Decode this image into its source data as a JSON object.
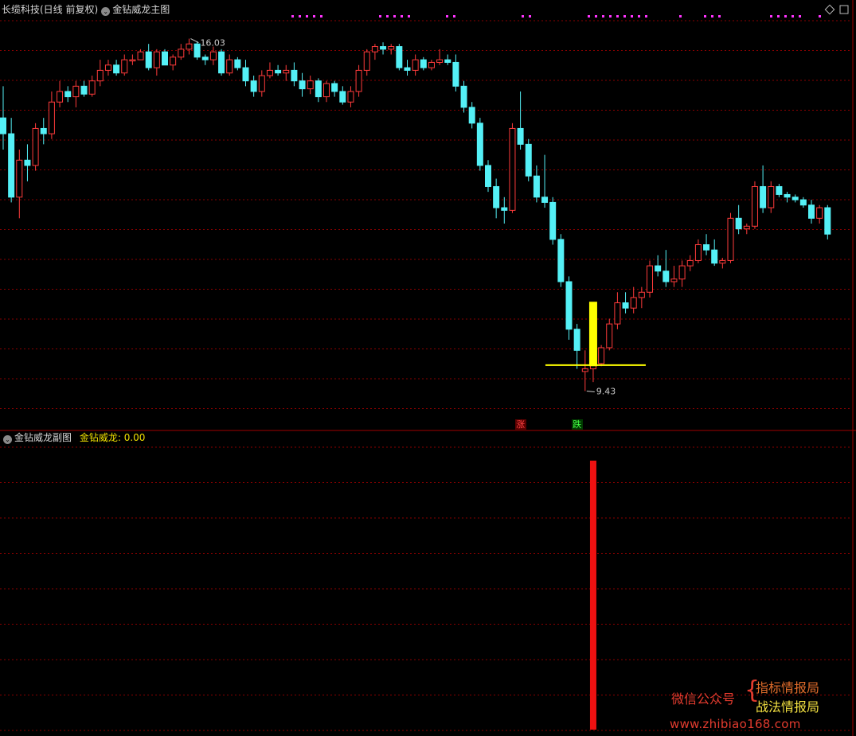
{
  "header": {
    "stock": "长缆科技(日线 前复权)",
    "main_indicator": "金钻威龙主图",
    "sub_indicator": "金钻威龙副图",
    "sub_value_label": "金钻威龙:",
    "sub_value": "0.00"
  },
  "colors": {
    "background": "#000000",
    "up_candle": "#ff3b3b",
    "down_candle": "#54f0f6",
    "grid": "#8a0000",
    "signal_bar": "#ffff00",
    "sub_bar": "#ee1111",
    "magenta_dots": "#ff33ff"
  },
  "chart_data": {
    "type": "candlestick",
    "x_index_note": "",
    "high_marker": "16.03",
    "low_marker": "9.43",
    "tag_up": "涨",
    "tag_down": "跌",
    "candles": [
      [
        14.6,
        15.2,
        14.0,
        14.3
      ],
      [
        14.3,
        14.6,
        13.0,
        13.1
      ],
      [
        13.1,
        14.0,
        12.7,
        13.8
      ],
      [
        13.8,
        14.1,
        13.4,
        13.7
      ],
      [
        13.7,
        14.5,
        13.6,
        14.4
      ],
      [
        14.4,
        14.6,
        14.1,
        14.3
      ],
      [
        14.3,
        15.1,
        14.2,
        14.9
      ],
      [
        14.9,
        15.3,
        14.8,
        15.1
      ],
      [
        15.1,
        15.2,
        14.9,
        15.0
      ],
      [
        15.0,
        15.3,
        14.8,
        15.2
      ],
      [
        15.2,
        15.3,
        15.0,
        15.05
      ],
      [
        15.05,
        15.4,
        15.0,
        15.3
      ],
      [
        15.3,
        15.7,
        15.2,
        15.5
      ],
      [
        15.5,
        15.7,
        15.4,
        15.6
      ],
      [
        15.6,
        15.7,
        15.4,
        15.45
      ],
      [
        15.45,
        15.8,
        15.4,
        15.7
      ],
      [
        15.7,
        15.8,
        15.6,
        15.7
      ],
      [
        15.7,
        15.9,
        15.7,
        15.85
      ],
      [
        15.85,
        16.0,
        15.5,
        15.55
      ],
      [
        15.55,
        15.9,
        15.4,
        15.85
      ],
      [
        15.85,
        15.9,
        15.6,
        15.6
      ],
      [
        15.6,
        15.8,
        15.5,
        15.75
      ],
      [
        15.75,
        16.0,
        15.7,
        15.9
      ],
      [
        15.9,
        16.1,
        15.8,
        16.0
      ],
      [
        16.0,
        16.05,
        15.7,
        15.75
      ],
      [
        15.75,
        15.8,
        15.6,
        15.7
      ],
      [
        15.7,
        15.95,
        15.6,
        15.85
      ],
      [
        15.85,
        15.9,
        15.4,
        15.45
      ],
      [
        15.45,
        15.8,
        15.4,
        15.7
      ],
      [
        15.7,
        15.75,
        15.5,
        15.55
      ],
      [
        15.55,
        15.7,
        15.2,
        15.3
      ],
      [
        15.3,
        15.4,
        15.0,
        15.1
      ],
      [
        15.1,
        15.5,
        15.0,
        15.4
      ],
      [
        15.4,
        15.65,
        15.35,
        15.5
      ],
      [
        15.5,
        15.6,
        15.4,
        15.45
      ],
      [
        15.45,
        15.6,
        15.3,
        15.5
      ],
      [
        15.5,
        15.65,
        15.2,
        15.3
      ],
      [
        15.3,
        15.45,
        15.0,
        15.15
      ],
      [
        15.15,
        15.4,
        15.05,
        15.3
      ],
      [
        15.3,
        15.35,
        14.9,
        15.0
      ],
      [
        15.0,
        15.3,
        14.9,
        15.25
      ],
      [
        15.25,
        15.3,
        15.0,
        15.1
      ],
      [
        15.1,
        15.2,
        14.85,
        14.9
      ],
      [
        14.9,
        15.2,
        14.8,
        15.1
      ],
      [
        15.1,
        15.6,
        15.0,
        15.5
      ],
      [
        15.5,
        15.9,
        15.4,
        15.85
      ],
      [
        15.85,
        16.0,
        15.7,
        15.95
      ],
      [
        15.95,
        16.03,
        15.8,
        15.9
      ],
      [
        15.9,
        16.0,
        15.8,
        15.95
      ],
      [
        15.95,
        16.0,
        15.5,
        15.55
      ],
      [
        15.55,
        15.7,
        15.4,
        15.5
      ],
      [
        15.5,
        15.8,
        15.4,
        15.7
      ],
      [
        15.7,
        15.75,
        15.5,
        15.55
      ],
      [
        15.55,
        15.7,
        15.5,
        15.65
      ],
      [
        15.65,
        15.9,
        15.6,
        15.7
      ],
      [
        15.7,
        15.8,
        15.6,
        15.65
      ],
      [
        15.65,
        15.8,
        15.1,
        15.2
      ],
      [
        15.2,
        15.3,
        14.7,
        14.8
      ],
      [
        14.8,
        14.9,
        14.4,
        14.5
      ],
      [
        14.5,
        14.6,
        13.6,
        13.7
      ],
      [
        13.7,
        13.8,
        13.2,
        13.3
      ],
      [
        13.3,
        13.45,
        12.7,
        12.9
      ],
      [
        12.9,
        13.1,
        12.6,
        12.85
      ],
      [
        12.85,
        14.5,
        12.8,
        14.4
      ],
      [
        14.4,
        15.1,
        14.0,
        14.1
      ],
      [
        14.1,
        14.2,
        13.4,
        13.5
      ],
      [
        13.5,
        13.7,
        13.0,
        13.1
      ],
      [
        13.1,
        13.9,
        12.9,
        13.0
      ],
      [
        13.0,
        13.1,
        12.2,
        12.3
      ],
      [
        12.3,
        12.4,
        11.4,
        11.5
      ],
      [
        11.5,
        11.6,
        10.4,
        10.6
      ],
      [
        10.6,
        10.7,
        9.85,
        10.2
      ],
      [
        9.8,
        10.2,
        9.43,
        9.85
      ],
      [
        9.85,
        10.3,
        9.6,
        9.95
      ],
      [
        9.95,
        10.3,
        9.9,
        10.25
      ],
      [
        10.25,
        10.8,
        10.2,
        10.7
      ],
      [
        10.7,
        11.3,
        10.6,
        11.1
      ],
      [
        11.1,
        11.3,
        10.9,
        11.0
      ],
      [
        11.0,
        11.4,
        10.9,
        11.2
      ],
      [
        11.2,
        11.4,
        11.0,
        11.3
      ],
      [
        11.3,
        11.9,
        11.2,
        11.8
      ],
      [
        11.8,
        12.0,
        11.6,
        11.7
      ],
      [
        11.7,
        12.1,
        11.4,
        11.5
      ],
      [
        11.5,
        11.8,
        11.4,
        11.55
      ],
      [
        11.55,
        11.9,
        11.4,
        11.8
      ],
      [
        11.8,
        12.0,
        11.7,
        11.9
      ],
      [
        11.9,
        12.3,
        11.85,
        12.2
      ],
      [
        12.2,
        12.4,
        12.0,
        12.1
      ],
      [
        12.1,
        12.3,
        11.8,
        11.85
      ],
      [
        11.85,
        11.95,
        11.75,
        11.9
      ],
      [
        11.9,
        12.8,
        11.85,
        12.7
      ],
      [
        12.7,
        12.95,
        12.4,
        12.5
      ],
      [
        12.5,
        12.6,
        12.4,
        12.55
      ],
      [
        12.55,
        13.4,
        12.5,
        13.3
      ],
      [
        13.3,
        13.7,
        12.8,
        12.9
      ],
      [
        12.9,
        13.4,
        12.8,
        13.3
      ],
      [
        13.3,
        13.35,
        13.1,
        13.15
      ],
      [
        13.15,
        13.2,
        13.0,
        13.1
      ],
      [
        13.1,
        13.15,
        13.0,
        13.05
      ],
      [
        13.05,
        13.1,
        12.9,
        12.95
      ],
      [
        12.95,
        13.05,
        12.6,
        12.7
      ],
      [
        12.7,
        12.95,
        12.6,
        12.9
      ],
      [
        12.9,
        12.95,
        12.3,
        12.4
      ]
    ],
    "signal_index": 73,
    "signal_range": [
      9.9,
      11.12
    ],
    "support_level": 9.92,
    "sub_bar_index": 73,
    "sub_bar_value": 1,
    "sub_ylim": [
      0,
      1.05
    ],
    "main_ylim": [
      9.0,
      16.5
    ]
  },
  "watermark": {
    "label": "微信公众号",
    "line1": "指标情报局",
    "line2": "战法情报局",
    "url": "www.zhibiao168.com"
  }
}
